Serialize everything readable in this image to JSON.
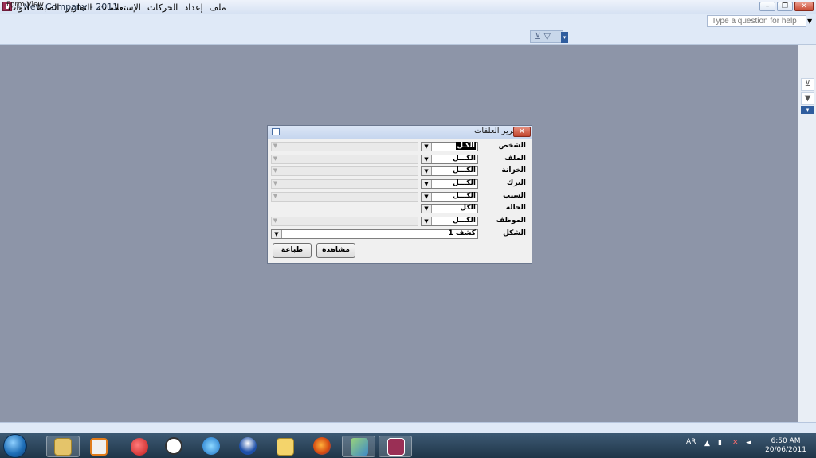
{
  "window": {
    "title": "- New Company - 2011"
  },
  "menu": {
    "items": [
      "ملف",
      "إعداد",
      "الحركات",
      "الإستعلامات",
      "التقارير",
      "الضبط",
      "أدوات"
    ]
  },
  "help": {
    "placeholder": "Type a question for help"
  },
  "dialog": {
    "title": "تقرير العلفات",
    "rows": [
      {
        "label": "الشخص",
        "value": "الكـل",
        "selected": true,
        "has_extra": true
      },
      {
        "label": "الملف",
        "value": "الكـــل",
        "has_extra": true
      },
      {
        "label": "الخزانة",
        "value": "الكـــل",
        "has_extra": true
      },
      {
        "label": "البرك",
        "value": "الكـــل",
        "has_extra": true
      },
      {
        "label": "السبب",
        "value": "الكـــل",
        "has_extra": true
      },
      {
        "label": "الحالة",
        "value": "الكل",
        "has_extra": false
      },
      {
        "label": "الموظف",
        "value": "الكـــل",
        "has_extra": true
      }
    ],
    "shape_label": "الشكل",
    "shape_value": "كشف 1",
    "preview_button": "مشاهدة",
    "print_button": "طباعة"
  },
  "status": {
    "text": "Form View"
  },
  "tray": {
    "language": "AR",
    "time": "6:50 AM",
    "date": "20/06/2011"
  },
  "colors": {
    "workspace": "#8d95a8",
    "accent": "#2f5d9e",
    "close": "#c1452d"
  }
}
